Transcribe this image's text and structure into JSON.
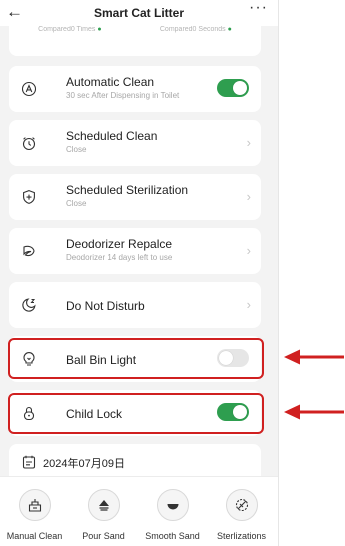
{
  "header": {
    "back_icon": "arrow-left-icon",
    "title": "Smart Cat Litter",
    "more_icon": "more-horizontal-icon"
  },
  "stats": {
    "left": "Compared0 Times",
    "right": "Compared0 Seconds"
  },
  "settings": [
    {
      "id": "automatic-clean",
      "icon": "auto-clean-icon",
      "label": "Automatic Clean",
      "subtitle": "30 sec After Dispensing in Toilet",
      "control": "toggle",
      "state": true
    },
    {
      "id": "scheduled-clean",
      "icon": "alarm-clock-icon",
      "label": "Scheduled Clean",
      "subtitle": "Close",
      "control": "chevron"
    },
    {
      "id": "scheduled-sterilization",
      "icon": "shield-plus-icon",
      "label": "Scheduled Sterilization",
      "subtitle": "Close",
      "control": "chevron"
    },
    {
      "id": "deodorizer-replace",
      "icon": "leaf-icon",
      "label": "Deodorizer Repalce",
      "subtitle": "Deodorizer 14 days left to use",
      "control": "chevron"
    },
    {
      "id": "do-not-disturb",
      "icon": "moon-icon",
      "label": "Do Not Disturb",
      "control": "chevron"
    },
    {
      "id": "ball-bin-light",
      "icon": "light-bulb-icon",
      "label": "Ball Bin Light",
      "control": "toggle",
      "state": false,
      "highlighted": true
    },
    {
      "id": "child-lock",
      "icon": "lock-icon",
      "label": "Child Lock",
      "control": "toggle",
      "state": true,
      "highlighted": true
    }
  ],
  "date_row": {
    "icon": "calendar-icon",
    "text": "2024年07月09日"
  },
  "tabbar": [
    {
      "label": "Manual Clean",
      "icon": "manual-clean-icon"
    },
    {
      "label": "Pour Sand",
      "icon": "pour-sand-icon"
    },
    {
      "label": "Smooth Sand",
      "icon": "smooth-sand-icon"
    },
    {
      "label": "Sterlizations",
      "icon": "sterilization-icon"
    }
  ],
  "colors": {
    "accent_green": "#2e9e4f",
    "annotation_red": "#d02020"
  }
}
